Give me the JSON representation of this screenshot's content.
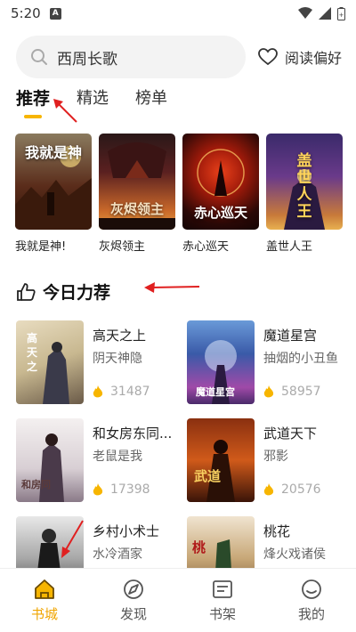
{
  "status_bar": {
    "time": "5:20"
  },
  "search": {
    "placeholder": "西周长歌"
  },
  "preference": {
    "label": "阅读偏好"
  },
  "tabs": [
    {
      "label": "推荐"
    },
    {
      "label": "精选"
    },
    {
      "label": "榜单"
    }
  ],
  "featured_books": [
    {
      "title": "我就是神!",
      "cover_text": "我就是神"
    },
    {
      "title": "灰烬领主",
      "cover_text": "灰烬领主"
    },
    {
      "title": "赤心巡天",
      "cover_text": "赤心巡天"
    },
    {
      "title": "盖世人王",
      "cover_text": "盖世人王"
    }
  ],
  "section": {
    "title": "今日力荐"
  },
  "recommended_books": [
    {
      "title": "高天之上",
      "author": "阴天神隐",
      "heat": "31487"
    },
    {
      "title": "魔道星宫",
      "author": "抽烟的小丑鱼",
      "heat": "58957"
    },
    {
      "title": "和女房东同...",
      "author": "老鼠是我",
      "heat": "17398"
    },
    {
      "title": "武道天下",
      "author": "邪影",
      "heat": "20576"
    },
    {
      "title": "乡村小术士",
      "author": "水冷酒家",
      "heat": ""
    },
    {
      "title": "桃花",
      "author": "烽火戏诸侯",
      "heat": ""
    }
  ],
  "bottom_nav": [
    {
      "label": "书城",
      "icon": "home-icon",
      "active": true
    },
    {
      "label": "发现",
      "icon": "discover-icon",
      "active": false
    },
    {
      "label": "书架",
      "icon": "bookshelf-icon",
      "active": false
    },
    {
      "label": "我的",
      "icon": "profile-icon",
      "active": false
    }
  ],
  "colors": {
    "accent": "#f7b500",
    "annotation_arrow": "#e02020",
    "heat_icon": "#f7b500"
  }
}
